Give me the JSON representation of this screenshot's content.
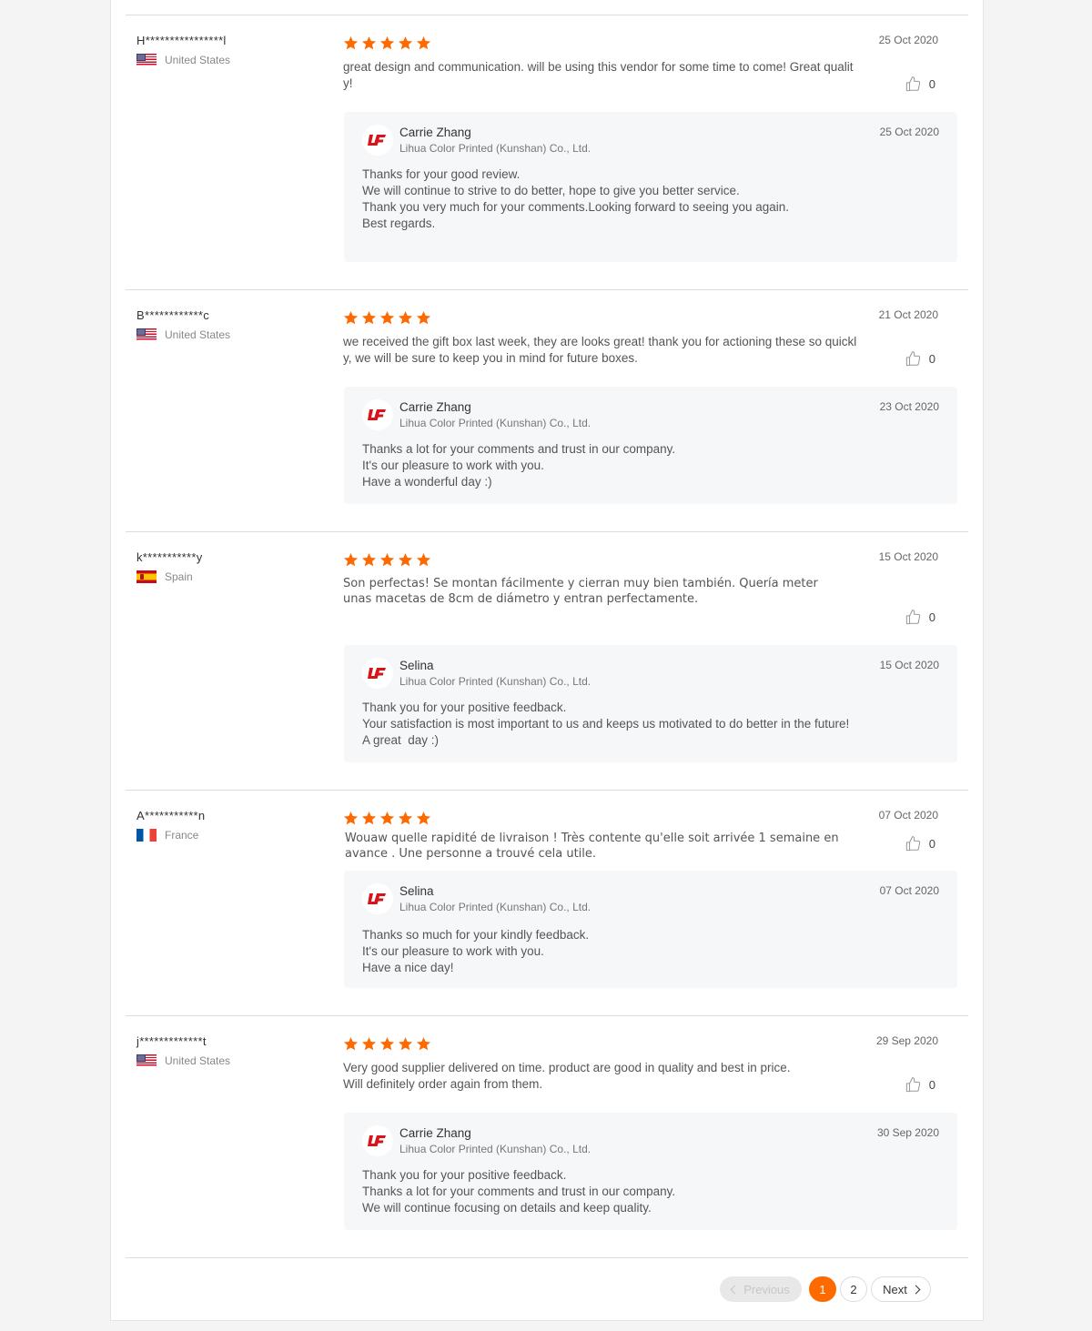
{
  "accent_color": "#ff6a00",
  "reviews": [
    {
      "reviewer": "H****************l",
      "country": "United States",
      "flag": "us-flag",
      "rating": 5,
      "date": "25 Oct  2020",
      "text": "great design and communication. will be using this vendor for some time to come! Great quality!",
      "likes": "0",
      "reply": {
        "name": "Carrie Zhang",
        "company": "Lihua Color Printed (Kunshan) Co., Ltd.",
        "date": "25 Oct 2020",
        "lines": [
          "Thanks for your good review.",
          "We will continue to strive to do better, hope to give you better service.",
          "Thank you very much for your comments.Looking forward to seeing you again.",
          "Best regards."
        ]
      }
    },
    {
      "reviewer": "B************c",
      "country": "United States",
      "flag": "us-flag",
      "rating": 5,
      "date": "21 Oct  2020",
      "text": "we received the gift box last week, they are looks great! thank you for actioning these so quickly, we will be sure to keep you in mind for future boxes.",
      "likes": "0",
      "reply": {
        "name": "Carrie Zhang",
        "company": "Lihua Color Printed (Kunshan) Co., Ltd.",
        "date": "23 Oct 2020",
        "lines": [
          "Thanks a lot for your comments and trust in our company.",
          "It's our pleasure to work with you.",
          "Have a wonderful day :)"
        ]
      }
    },
    {
      "reviewer": "k***********y",
      "country": "Spain",
      "flag": "spain-flag",
      "rating": 5,
      "date": "15 Oct  2020",
      "text": "Son perfectas! Se montan fácilmente y cierran muy bien también. Quería meter unas macetas de 8cm de diámetro y entran perfectamente.",
      "likes": "0",
      "reply": {
        "name": "Selina",
        "company": "Lihua Color Printed (Kunshan) Co., Ltd.",
        "date": "15 Oct 2020",
        "lines": [
          "Thank you for your positive feedback.",
          "Your satisfaction is most important to us and keeps us motivated to do better in the future!",
          "A great  day :)"
        ]
      }
    },
    {
      "reviewer": "A***********n",
      "country": "France",
      "flag": "france-flag",
      "rating": 5,
      "date": "07 Oct  2020",
      "text": "Wouaw quelle rapidité de livraison ! Très contente qu'elle soit arrivée 1 semaine en avance .  Une personne a trouvé cela utile.",
      "likes": "0",
      "reply": {
        "name": "Selina",
        "company": "Lihua Color Printed (Kunshan) Co., Ltd.",
        "date": "07 Oct 2020",
        "lines": [
          "Thanks so much for your kindly feedback.",
          "It's our pleasure to work with you.",
          "Have a nice day!"
        ]
      }
    },
    {
      "reviewer": "j*************t",
      "country": "United States",
      "flag": "us-flag",
      "rating": 5,
      "date": "29 Sep  2020",
      "text_lines": [
        "Very good supplier delivered on time. product are good in quality and best in price.",
        "Will definitely order again from them."
      ],
      "likes": "0",
      "reply": {
        "name": "Carrie Zhang",
        "company": "Lihua Color Printed (Kunshan) Co., Ltd.",
        "date": "30 Sep 2020",
        "lines": [
          "Thank you for your positive feedback.",
          "Thanks a lot for your comments and trust in our company.",
          "We will continue focusing on details and keep quality."
        ]
      }
    }
  ],
  "pagination": {
    "previous": "Previous",
    "pages": [
      "1",
      "2"
    ],
    "current": "1",
    "next": "Next"
  }
}
